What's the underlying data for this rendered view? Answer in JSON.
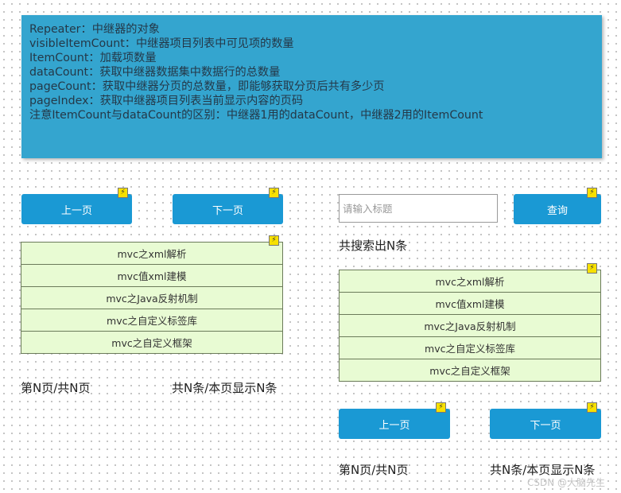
{
  "note": {
    "lines": [
      "Repeater：中继器的对象",
      "visibleItemCount：中继器项目列表中可见项的数量",
      "ItemCount：加载项数量",
      "dataCount：获取中继器数据集中数据行的总数量",
      "pageCount：获取中继器分页的总数量，即能够获取分页后共有多少页",
      "pageIndex：获取中继器项目列表当前显示内容的页码",
      "注意ItemCount与dataCount的区别：中继器1用的dataCount，中继器2用的ItemCount"
    ]
  },
  "left": {
    "prev_label": "上一页",
    "next_label": "下一页",
    "items": [
      "mvc之xml解析",
      "mvc值xml建模",
      "mvc之Java反射机制",
      "mvc之自定义标签库",
      "mvc之自定义框架"
    ],
    "page_info": "第N页/共N页",
    "count_info": "共N条/本页显示N条"
  },
  "right": {
    "search_placeholder": "请输入标题",
    "query_label": "查询",
    "result_text": "共搜索出N条",
    "items": [
      "mvc之xml解析",
      "mvc值xml建模",
      "mvc之Java反射机制",
      "mvc之自定义标签库",
      "mvc之自定义框架"
    ],
    "prev_label": "上一页",
    "next_label": "下一页",
    "page_info": "第N页/共N页",
    "count_info": "共N条/本页显示N条"
  },
  "interaction_icon": "⚡",
  "watermark": "CSDN @大脑先生",
  "colors": {
    "note_bg": "#34a5cf",
    "button_bg": "#1a99d4",
    "row_bg": "#e8fbd3",
    "bolt": "#f7e000"
  }
}
